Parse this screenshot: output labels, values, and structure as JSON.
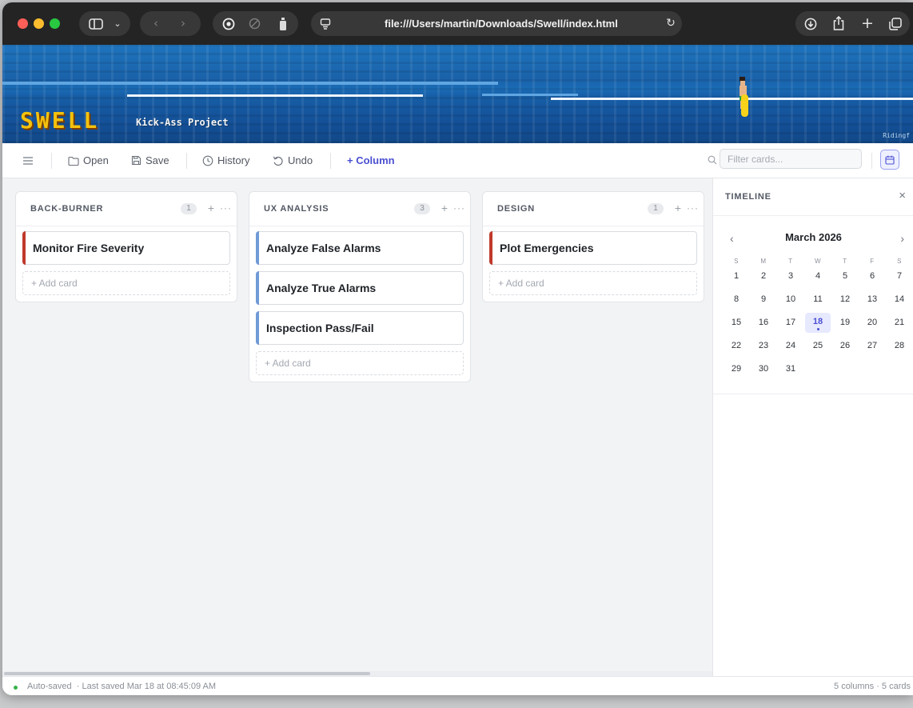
{
  "browser": {
    "url": "file:///Users/martin/Downloads/Swell/index.html"
  },
  "banner": {
    "logo": "SWELL",
    "subtitle": "Kick-Ass Project",
    "credit": "Ridingf"
  },
  "toolbar": {
    "open_label": "Open",
    "save_label": "Save",
    "history_label": "History",
    "undo_label": "Undo",
    "column_label": "+ Column",
    "filter_placeholder": "Filter cards..."
  },
  "columns": [
    {
      "title": "BACK-BURNER",
      "count": "1",
      "cards": [
        {
          "title": "Monitor Fire Severity",
          "accent": "#c0392b"
        }
      ],
      "add_label": "+ Add card"
    },
    {
      "title": "UX ANALYSIS",
      "count": "3",
      "cards": [
        {
          "title": "Analyze False Alarms",
          "accent": "#6f9bd6"
        },
        {
          "title": "Analyze True Alarms",
          "accent": "#6f9bd6"
        },
        {
          "title": "Inspection Pass/Fail",
          "accent": "#6f9bd6"
        }
      ],
      "add_label": "+ Add card"
    },
    {
      "title": "DESIGN",
      "count": "1",
      "cards": [
        {
          "title": "Plot Emergencies",
          "accent": "#c0392b"
        }
      ],
      "add_label": "+ Add card"
    }
  ],
  "timeline": {
    "title": "TIMELINE",
    "month": "March 2026",
    "weekdays": [
      "S",
      "M",
      "T",
      "W",
      "T",
      "F",
      "S"
    ],
    "weeks": [
      [
        "1",
        "2",
        "3",
        "4",
        "5",
        "6",
        "7"
      ],
      [
        "8",
        "9",
        "10",
        "11",
        "12",
        "13",
        "14"
      ],
      [
        "15",
        "16",
        "17",
        "18",
        "19",
        "20",
        "21"
      ],
      [
        "22",
        "23",
        "24",
        "25",
        "26",
        "27",
        "28"
      ],
      [
        "29",
        "30",
        "31"
      ]
    ],
    "today": "18"
  },
  "status": {
    "left": "Auto-saved  · Last saved Mar 18 at 08:45:09 AM",
    "right": "5 columns · 5 cards"
  },
  "colors": {
    "accent": "#4a4fd1",
    "urgent": "#c0392b",
    "normal": "#6f9bd6",
    "saved": "#36b24a"
  }
}
